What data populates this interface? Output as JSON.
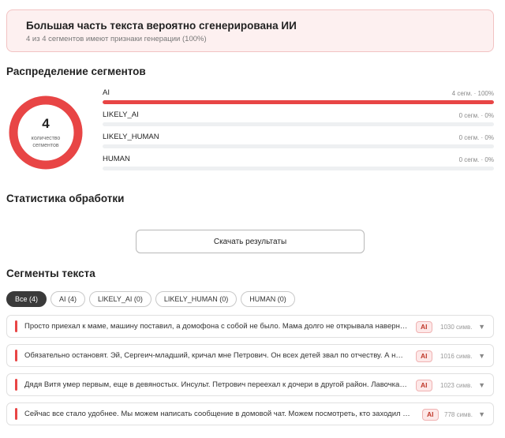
{
  "alert": {
    "title": "Большая часть текста вероятно сгенерирована ИИ",
    "subtitle": "4 из 4 сегментов имеют признаки генерации (100%)"
  },
  "distribution": {
    "title": "Распределение сегментов",
    "total": "4",
    "total_label": "количество сегментов",
    "rows": [
      {
        "label": "AI",
        "value": "4 сегм. · 100%",
        "fraction": 1.0,
        "color": "#e84545"
      },
      {
        "label": "LIKELY_AI",
        "value": "0 сегм. · 0%",
        "fraction": 0.0,
        "color": "#f0a04b"
      },
      {
        "label": "LIKELY_HUMAN",
        "value": "0 сегм. · 0%",
        "fraction": 0.0,
        "color": "#7ab6e8"
      },
      {
        "label": "HUMAN",
        "value": "0 сегм. · 0%",
        "fraction": 0.0,
        "color": "#4caf50"
      }
    ]
  },
  "stats": {
    "title": "Статистика обработки",
    "download_label": "Скачать результаты"
  },
  "segments": {
    "title": "Сегменты текста",
    "filters": [
      "Все (4)",
      "AI (4)",
      "LIKELY_AI (0)",
      "LIKELY_HUMAN (0)",
      "HUMAN (0)"
    ],
    "items": [
      {
        "text": "Просто приехал к маме, машину поставил, а домофона с собой не было. Мама долго не открывала наверное…",
        "badge": "AI",
        "chars": "1030 симв."
      },
      {
        "text": "Обязательно остановят. Эй, Сергеич-младший, кричал мне Петрович. Он всех детей звал по отчеству. А н…",
        "badge": "AI",
        "chars": "1016 симв."
      },
      {
        "text": "Дядя Витя умер первым, еще в девяностых. Инсульт. Петрович переехал к дочери в другой район. Лавочка…",
        "badge": "AI",
        "chars": "1023 симв."
      },
      {
        "text": "Сейчас все стало удобнее. Мы можем написать сообщение в домовой чат. Можем посмотреть, кто заходил в…",
        "badge": "AI",
        "chars": "778 симв."
      }
    ]
  },
  "colors": {
    "accent": "#e84545",
    "track": "#eef0f2"
  }
}
